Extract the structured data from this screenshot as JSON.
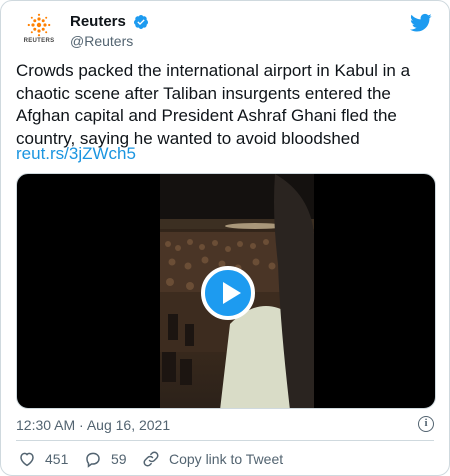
{
  "account": {
    "display_name": "Reuters",
    "handle": "@Reuters",
    "avatar_wordmark": "REUTERS"
  },
  "tweet": {
    "text": "Crowds packed the international airport in Kabul in a chaotic scene after Taliban insurgents entered the Afghan capital and President Ashraf Ghani fled the country, saying he wanted to avoid bloodshed",
    "link": "reut.rs/3jZWch5"
  },
  "meta": {
    "timestamp": "12:30 AM · Aug 16, 2021",
    "info_glyph": "i"
  },
  "actions": {
    "likes": "451",
    "replies": "59",
    "copy_link": "Copy link to Tweet"
  },
  "colors": {
    "accent": "#1d9bf0",
    "link": "#1b95e0",
    "muted": "#536471",
    "border": "#cfd9de",
    "reuters_orange": "#ff8000"
  },
  "icons": [
    "reuters-logo-icon",
    "verified-badge-icon",
    "twitter-bird-icon",
    "play-icon",
    "info-icon",
    "heart-icon",
    "reply-icon",
    "link-icon"
  ]
}
